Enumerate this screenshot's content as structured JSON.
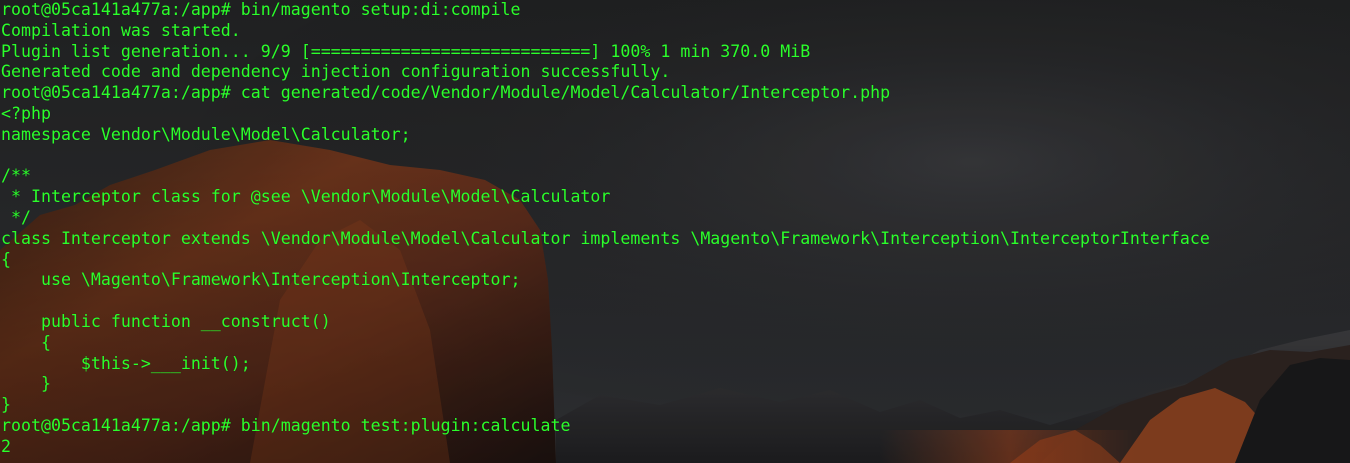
{
  "terminal": {
    "lines": [
      "root@05ca141a477a:/app# bin/magento setup:di:compile",
      "Compilation was started.",
      "Plugin list generation... 9/9 [============================] 100% 1 min 370.0 MiB",
      "Generated code and dependency injection configuration successfully.",
      "root@05ca141a477a:/app# cat generated/code/Vendor/Module/Model/Calculator/Interceptor.php",
      "<?php",
      "namespace Vendor\\Module\\Model\\Calculator;",
      "",
      "/**",
      " * Interceptor class for @see \\Vendor\\Module\\Model\\Calculator",
      " */",
      "class Interceptor extends \\Vendor\\Module\\Model\\Calculator implements \\Magento\\Framework\\Interception\\InterceptorInterface",
      "{",
      "    use \\Magento\\Framework\\Interception\\Interceptor;",
      "",
      "    public function __construct()",
      "    {",
      "        $this->___init();",
      "    }",
      "}",
      "root@05ca141a477a:/app# bin/magento test:plugin:calculate",
      "2"
    ]
  },
  "colors": {
    "text": "#2bff2b",
    "background": "#1d1e1f"
  }
}
